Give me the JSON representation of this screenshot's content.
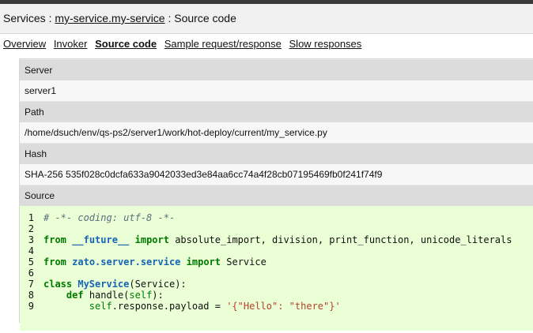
{
  "header": {
    "prefix": "Services : ",
    "service_link": "my-service.my-service",
    "suffix": " : Source code"
  },
  "nav": {
    "items": [
      {
        "label": "Overview",
        "active": false
      },
      {
        "label": "Invoker",
        "active": false
      },
      {
        "label": "Source code",
        "active": true
      },
      {
        "label": "Sample request/response",
        "active": false
      },
      {
        "label": "Slow responses",
        "active": false
      }
    ]
  },
  "details": {
    "server_label": "Server",
    "server_value": "server1",
    "path_label": "Path",
    "path_value": "/home/dsuch/env/qs-ps2/server1/work/hot-deploy/current/my_service.py",
    "hash_label": "Hash",
    "hash_value": "SHA-256 535f028c0dcfa633a9042033ed3e84aa6cc74a4f28cb07195469fb0f241f74f9",
    "source_label": "Source"
  },
  "source": {
    "lines": [
      {
        "num": "1",
        "tokens": [
          {
            "t": "# -*- coding: utf-8 -*-",
            "c": "c-comment"
          }
        ]
      },
      {
        "num": "2",
        "tokens": []
      },
      {
        "num": "3",
        "tokens": [
          {
            "t": "from",
            "c": "c-kw"
          },
          {
            "t": " ",
            "c": "c-plain"
          },
          {
            "t": "__future__",
            "c": "c-mod"
          },
          {
            "t": " ",
            "c": "c-plain"
          },
          {
            "t": "import",
            "c": "c-kw"
          },
          {
            "t": " absolute_import, division, print_function, unicode_literals",
            "c": "c-plain"
          }
        ]
      },
      {
        "num": "4",
        "tokens": []
      },
      {
        "num": "5",
        "tokens": [
          {
            "t": "from",
            "c": "c-kw"
          },
          {
            "t": " ",
            "c": "c-plain"
          },
          {
            "t": "zato.server.service",
            "c": "c-mod"
          },
          {
            "t": " ",
            "c": "c-plain"
          },
          {
            "t": "import",
            "c": "c-kw"
          },
          {
            "t": " Service",
            "c": "c-plain"
          }
        ]
      },
      {
        "num": "6",
        "tokens": []
      },
      {
        "num": "7",
        "tokens": [
          {
            "t": "class",
            "c": "c-kw"
          },
          {
            "t": " ",
            "c": "c-plain"
          },
          {
            "t": "MyService",
            "c": "c-cls"
          },
          {
            "t": "(Service):",
            "c": "c-plain"
          }
        ]
      },
      {
        "num": "8",
        "tokens": [
          {
            "t": "    ",
            "c": "c-plain"
          },
          {
            "t": "def",
            "c": "c-kw"
          },
          {
            "t": " handle(",
            "c": "c-plain"
          },
          {
            "t": "self",
            "c": "c-self"
          },
          {
            "t": "):",
            "c": "c-plain"
          }
        ]
      },
      {
        "num": "9",
        "tokens": [
          {
            "t": "        ",
            "c": "c-plain"
          },
          {
            "t": "self",
            "c": "c-self"
          },
          {
            "t": ".response.payload = ",
            "c": "c-plain"
          },
          {
            "t": "'{\"Hello\": \"there\"}'",
            "c": "c-str"
          }
        ]
      }
    ]
  }
}
